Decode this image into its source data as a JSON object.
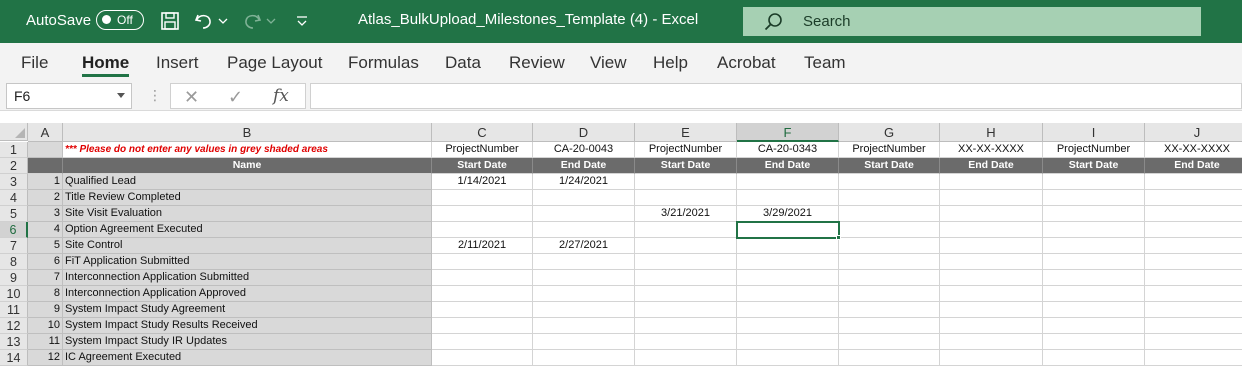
{
  "titlebar": {
    "autosave_label": "AutoSave",
    "autosave_state": "Off",
    "doc_title": "Atlas_BulkUpload_Milestones_Template (4)  -  Excel",
    "search_placeholder": "Search"
  },
  "ribbon": {
    "tabs": [
      {
        "label": "File"
      },
      {
        "label": "Home"
      },
      {
        "label": "Insert"
      },
      {
        "label": "Page Layout"
      },
      {
        "label": "Formulas"
      },
      {
        "label": "Data"
      },
      {
        "label": "Review"
      },
      {
        "label": "View"
      },
      {
        "label": "Help"
      },
      {
        "label": "Acrobat"
      },
      {
        "label": "Team"
      }
    ],
    "active_tab": "Home"
  },
  "formula_bar": {
    "name_box": "F6",
    "fx": "fx",
    "formula": ""
  },
  "sheet": {
    "columns": [
      "A",
      "B",
      "C",
      "D",
      "E",
      "F",
      "G",
      "H",
      "I",
      "J"
    ],
    "selected_column": "F",
    "row_numbers": [
      "1",
      "2",
      "3",
      "4",
      "5",
      "6",
      "7",
      "8",
      "9",
      "10",
      "11",
      "12",
      "13",
      "14"
    ],
    "selected_row": "6",
    "warning": "*** Please do not enter any values in grey shaded areas",
    "row1": [
      "ProjectNumber",
      "CA-20-0043",
      "ProjectNumber",
      "CA-20-0343",
      "ProjectNumber",
      "XX-XX-XXXX",
      "ProjectNumber",
      "XX-XX-XXXX"
    ],
    "row2_name": "Name",
    "row2": [
      "Start Date",
      "End Date",
      "Start Date",
      "End Date",
      "Start Date",
      "End Date",
      "Start Date",
      "End Date"
    ],
    "milestones": [
      {
        "num": "1",
        "name": "Qualified Lead",
        "c": "1/14/2021",
        "d": "1/24/2021",
        "e": "",
        "f": ""
      },
      {
        "num": "2",
        "name": "Title Review Completed",
        "c": "",
        "d": "",
        "e": "",
        "f": ""
      },
      {
        "num": "3",
        "name": "Site Visit Evaluation",
        "c": "",
        "d": "",
        "e": "3/21/2021",
        "f": "3/29/2021"
      },
      {
        "num": "4",
        "name": "Option Agreement Executed",
        "c": "",
        "d": "",
        "e": "",
        "f": ""
      },
      {
        "num": "5",
        "name": "Site Control",
        "c": "2/11/2021",
        "d": "2/27/2021",
        "e": "",
        "f": ""
      },
      {
        "num": "6",
        "name": "FiT Application Submitted",
        "c": "",
        "d": "",
        "e": "",
        "f": ""
      },
      {
        "num": "7",
        "name": "Interconnection Application Submitted",
        "c": "",
        "d": "",
        "e": "",
        "f": ""
      },
      {
        "num": "8",
        "name": "Interconnection Application Approved",
        "c": "",
        "d": "",
        "e": "",
        "f": ""
      },
      {
        "num": "9",
        "name": "System Impact Study Agreement",
        "c": "",
        "d": "",
        "e": "",
        "f": ""
      },
      {
        "num": "10",
        "name": "System Impact Study Results Received",
        "c": "",
        "d": "",
        "e": "",
        "f": ""
      },
      {
        "num": "11",
        "name": "System Impact Study IR Updates",
        "c": "",
        "d": "",
        "e": "",
        "f": ""
      },
      {
        "num": "12",
        "name": "IC Agreement Executed",
        "c": "",
        "d": "",
        "e": "",
        "f": ""
      }
    ]
  },
  "colors": {
    "excel_green": "#217346",
    "grey_cell": "#d9d9d9",
    "header_dark": "#6b6b6b",
    "warning_red": "#e00000"
  }
}
